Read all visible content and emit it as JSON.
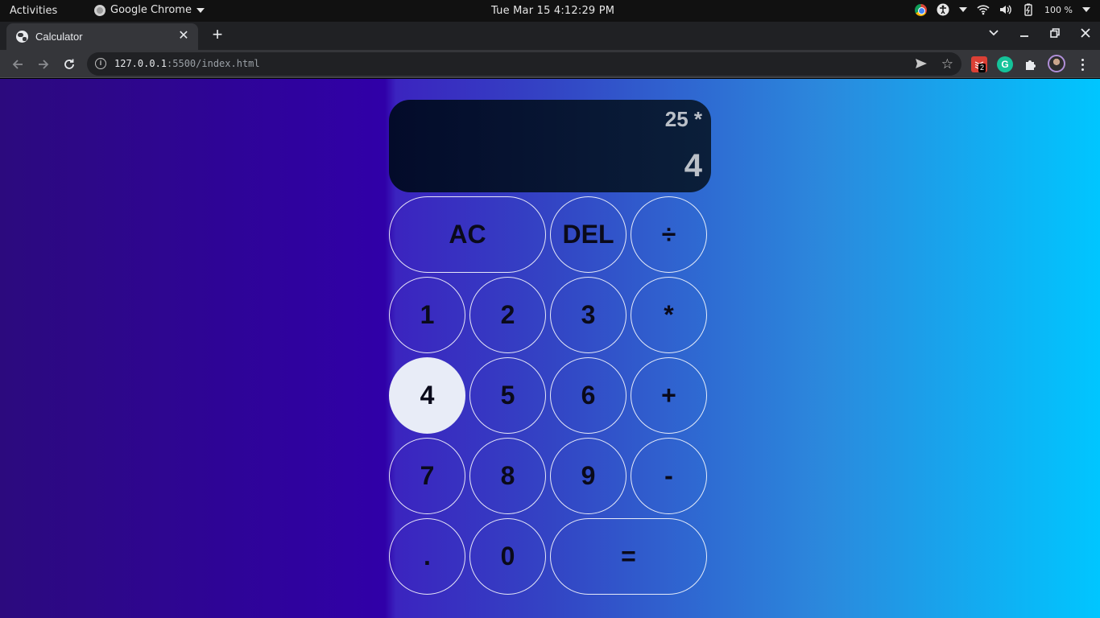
{
  "system_bar": {
    "activities": "Activities",
    "app_name": "Google Chrome",
    "clock": "Tue Mar 15  4:12:29 PM",
    "battery": "100 %"
  },
  "browser": {
    "tab_title": "Calculator",
    "url_host": "127.0.0.1",
    "url_rest": ":5500/index.html",
    "extension_badge": "2",
    "grammarly_glyph": "G"
  },
  "calculator": {
    "previous_operand": "25 *",
    "current_operand": "4",
    "keys": {
      "ac": "AC",
      "del": "DEL",
      "divide": "÷",
      "one": "1",
      "two": "2",
      "three": "3",
      "multiply": "*",
      "four": "4",
      "five": "5",
      "six": "6",
      "plus": "+",
      "seven": "7",
      "eight": "8",
      "nine": "9",
      "minus": "-",
      "dot": ".",
      "zero": "0",
      "equals": "="
    },
    "active_key": "4"
  },
  "colors": {
    "gradient_start": "#2c0a7e",
    "gradient_end": "#00c6ff",
    "display_bg": "#030b2a",
    "active_key_bg": "#e8ecf7"
  }
}
